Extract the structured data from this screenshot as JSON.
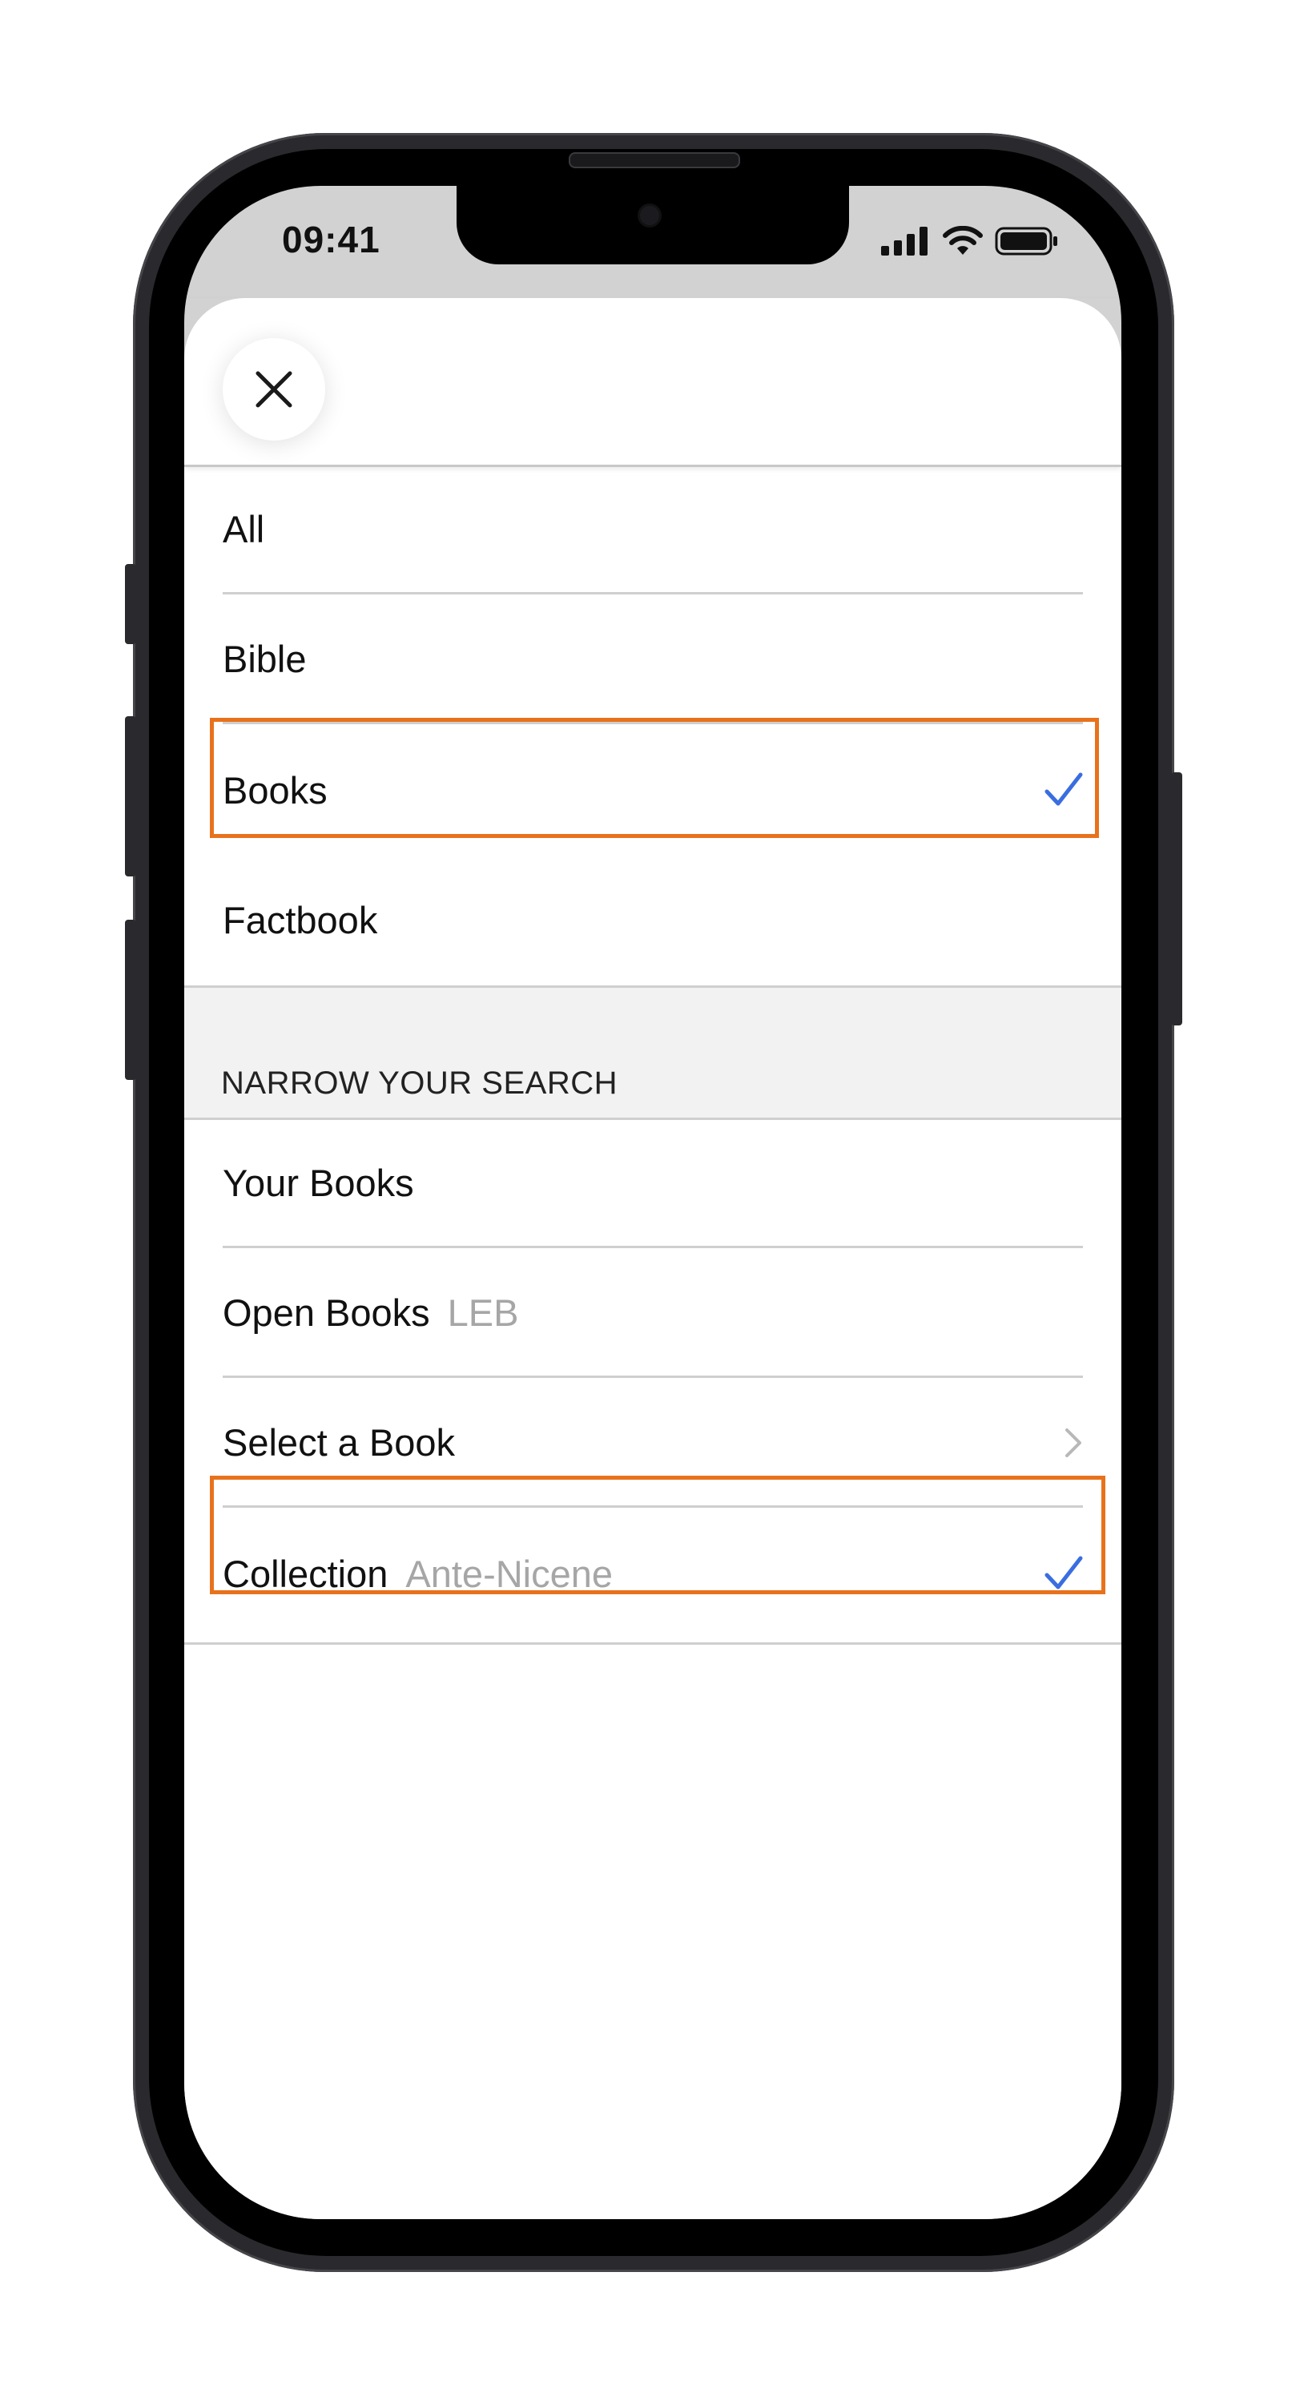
{
  "status_bar": {
    "time": "09:41"
  },
  "close_button": {
    "icon": "close-icon"
  },
  "scope_options": [
    {
      "label": "All",
      "selected": false
    },
    {
      "label": "Bible",
      "selected": false
    },
    {
      "label": "Books",
      "selected": true
    },
    {
      "label": "Factbook",
      "selected": false
    }
  ],
  "narrow_section": {
    "title": "NARROW YOUR SEARCH",
    "items": [
      {
        "label": "Your Books",
        "detail": "",
        "selected": false,
        "trailing": "none"
      },
      {
        "label": "Open Books",
        "detail": "LEB",
        "selected": false,
        "trailing": "none"
      },
      {
        "label": "Select a Book",
        "detail": "",
        "selected": false,
        "trailing": "chevron-right-icon"
      },
      {
        "label": "Collection",
        "detail": "Ante-Nicene",
        "selected": true,
        "trailing": "checkmark-icon"
      }
    ]
  },
  "colors": {
    "checkmark": "#3a6ee0",
    "highlight_outline": "#e8721c",
    "section_background": "#f2f2f2",
    "secondary_text": "#a6a6a6"
  }
}
